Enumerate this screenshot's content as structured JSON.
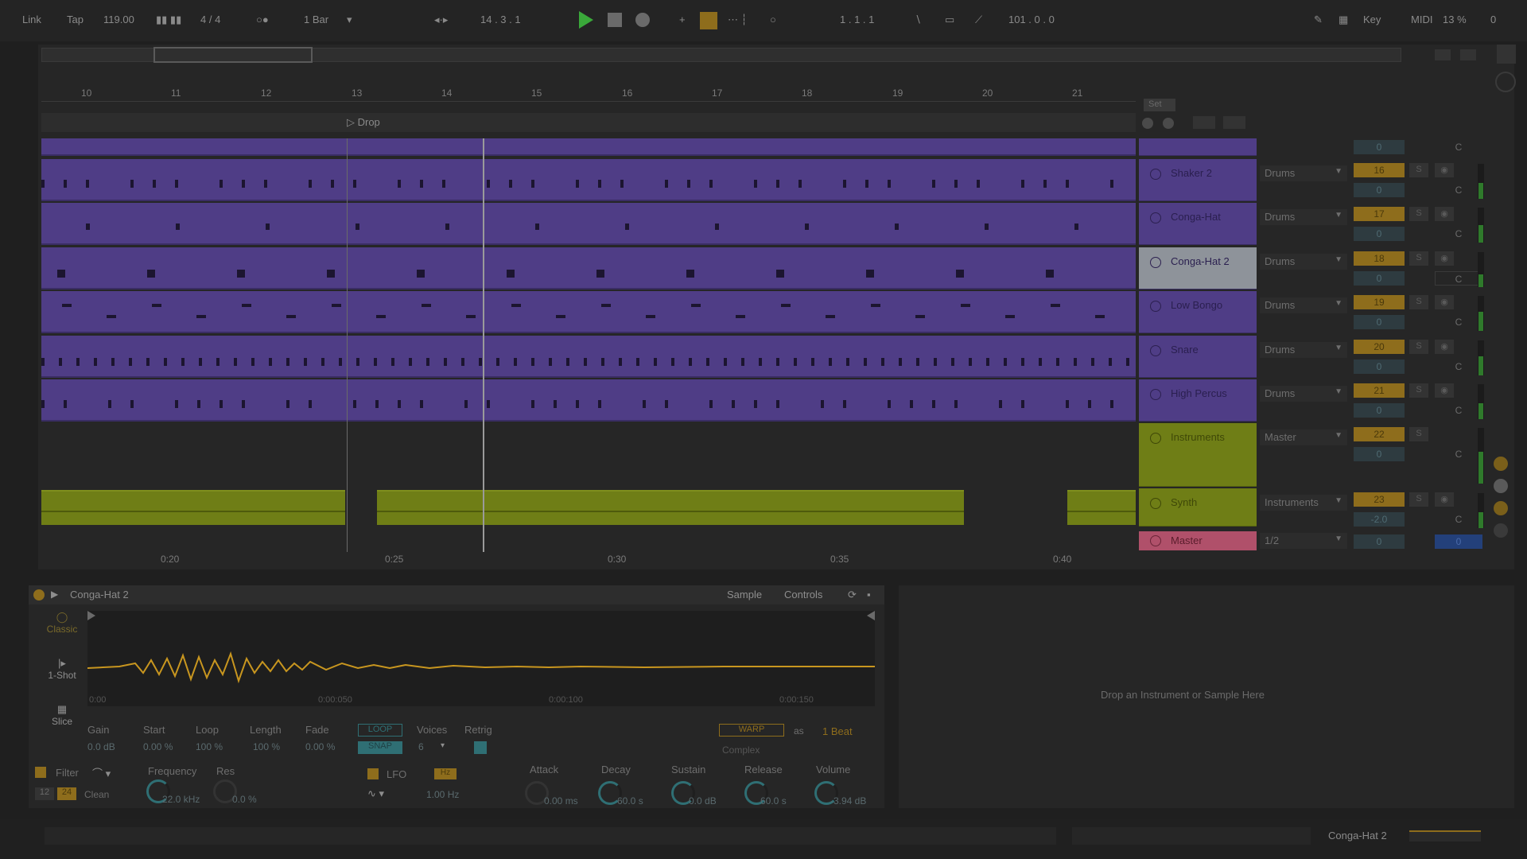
{
  "transport": {
    "link": "Link",
    "tap": "Tap",
    "tempo": "119.00",
    "signature": "4 / 4",
    "quantize": "1 Bar",
    "position": "14 .  3 .  1",
    "loop_start": "1 .  1 .  1",
    "loop_length": "101 .  0 .  0",
    "key": "Key",
    "midi": "MIDI",
    "cpu": "13 %",
    "disk": "0",
    "play_color": "#3aa83a"
  },
  "ruler": {
    "bars": [
      "10",
      "11",
      "12",
      "13",
      "14",
      "15",
      "16",
      "17",
      "18",
      "19",
      "20",
      "21"
    ],
    "locator": "Drop",
    "times": [
      "0:20",
      "0:25",
      "0:30",
      "0:35",
      "0:40"
    ]
  },
  "mixer": {
    "set_label": "Set",
    "tracks": [
      {
        "name": "Shaker 2",
        "route": "Drums",
        "num": "16",
        "vol": "0",
        "pan": "C"
      },
      {
        "name": "Conga-Hat",
        "route": "Drums",
        "num": "17",
        "vol": "0",
        "pan": "C"
      },
      {
        "name": "Conga-Hat 2",
        "route": "Drums",
        "num": "18",
        "vol": "0",
        "pan": "C"
      },
      {
        "name": "Low Bongo",
        "route": "Drums",
        "num": "19",
        "vol": "0",
        "pan": "C"
      },
      {
        "name": "Snare",
        "route": "Drums",
        "num": "20",
        "vol": "0",
        "pan": "C"
      },
      {
        "name": "High Percus",
        "route": "Drums",
        "num": "21",
        "vol": "0",
        "pan": "C"
      },
      {
        "name": "Instruments",
        "route": "Master",
        "num": "22",
        "vol": "0",
        "pan": "C"
      },
      {
        "name": "Synth",
        "route": "Instruments",
        "num": "23",
        "vol": "-2.0",
        "pan": "C"
      },
      {
        "name": "Master",
        "route": "1/2",
        "num": "",
        "vol": "0",
        "pan": "0"
      }
    ],
    "top_vol": "0",
    "top_pan": "C"
  },
  "device": {
    "title": "Conga-Hat 2",
    "tab_sample": "Sample",
    "tab_controls": "Controls",
    "mode_classic": "Classic",
    "mode_oneshot": "1-Shot",
    "mode_slice": "Slice",
    "wave_times": [
      "0:00",
      "0:00:050",
      "0:00:100",
      "0:00:150"
    ],
    "params": [
      {
        "label": "Gain",
        "value": "0.0 dB"
      },
      {
        "label": "Start",
        "value": "0.00 %"
      },
      {
        "label": "Loop",
        "value": "100 %"
      },
      {
        "label": "Length",
        "value": "100 %"
      },
      {
        "label": "Fade",
        "value": "0.00 %"
      }
    ],
    "loop_btn": "LOOP",
    "snap_btn": "SNAP",
    "voices_label": "Voices",
    "voices_value": "6",
    "retrig_label": "Retrig",
    "warp_btn": "WARP",
    "warp_as": "as",
    "warp_beats": "1 Beat",
    "warp_mode": "Complex",
    "filter_label": "Filter",
    "filter_type": "Clean",
    "filter_12": "12",
    "filter_24": "24",
    "frequency_label": "Frequency",
    "frequency_value": "22.0 kHz",
    "res_label": "Res",
    "res_value": "0.0 %",
    "lfo_label": "LFO",
    "lfo_hz_btn": "Hz",
    "lfo_rate": "1.00 Hz",
    "attack_label": "Attack",
    "attack_value": "0.00 ms",
    "decay_label": "Decay",
    "decay_value": "60.0 s",
    "sustain_label": "Sustain",
    "sustain_value": "0.0 dB",
    "release_label": "Release",
    "release_value": "60.0 s",
    "volume_label": "Volume",
    "volume_value": "-3.94 dB"
  },
  "dropzone": "Drop an Instrument or Sample Here",
  "status": {
    "track_name": "Conga-Hat 2"
  },
  "colors": {
    "purple_clip": "#4f3d86",
    "green_clip": "#6f7e16",
    "master_pink": "#b0506a",
    "accent_orange": "#c8961f"
  }
}
